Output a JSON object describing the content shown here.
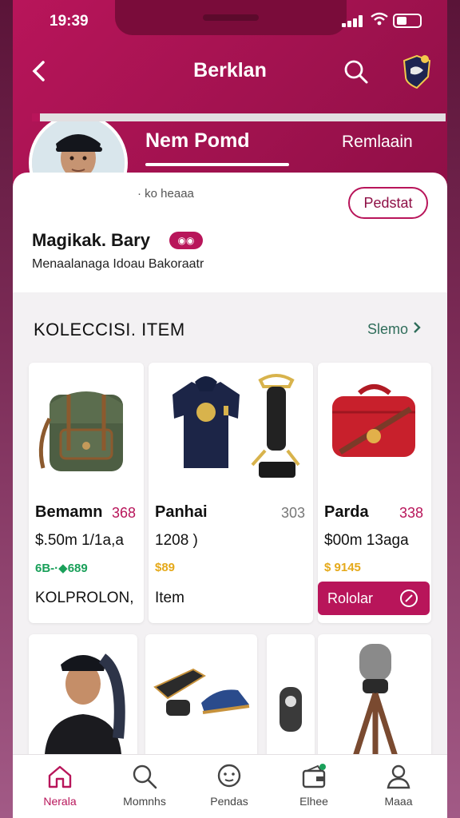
{
  "status": {
    "time": "19:39"
  },
  "header": {
    "title": "Berklan"
  },
  "profile": {
    "tabs": [
      {
        "label": "Nem Pomd"
      },
      {
        "label": "Remlaain"
      }
    ],
    "handle": "· ko heaaa",
    "follow_label": "Pedstat",
    "name": "Magikak. Bary",
    "subtitle": "Menaalanaga  Idoau Bakoraatr",
    "progress": 0.02
  },
  "section": {
    "title": "KOLECCISI. ITEM",
    "link": "Slemo"
  },
  "products": [
    {
      "name": "Bemamn",
      "count": "368",
      "price": "$.50m 1/1a,a",
      "tag": "6B-·◆689",
      "footer": "KOLPROLON,"
    },
    {
      "name": "Panhai",
      "count": "303",
      "price": "1208 )",
      "tag": "$89",
      "footer": "Item"
    },
    {
      "name": "Parda",
      "count": "338",
      "price": "$00m 13aga",
      "tag": "$ 9145",
      "button": "Rololar"
    }
  ],
  "bottom_nav": [
    {
      "label": "Nerala",
      "icon": "home-icon"
    },
    {
      "label": "Momnhs",
      "icon": "search-icon"
    },
    {
      "label": "Pendas",
      "icon": "chat-face-icon"
    },
    {
      "label": "Elhee",
      "icon": "wallet-icon"
    },
    {
      "label": "Maaa",
      "icon": "user-icon"
    }
  ],
  "colors": {
    "accent": "#b8155a",
    "accent_dark": "#8e0f46",
    "green": "#1aa05a",
    "gold": "#e5a91a"
  }
}
